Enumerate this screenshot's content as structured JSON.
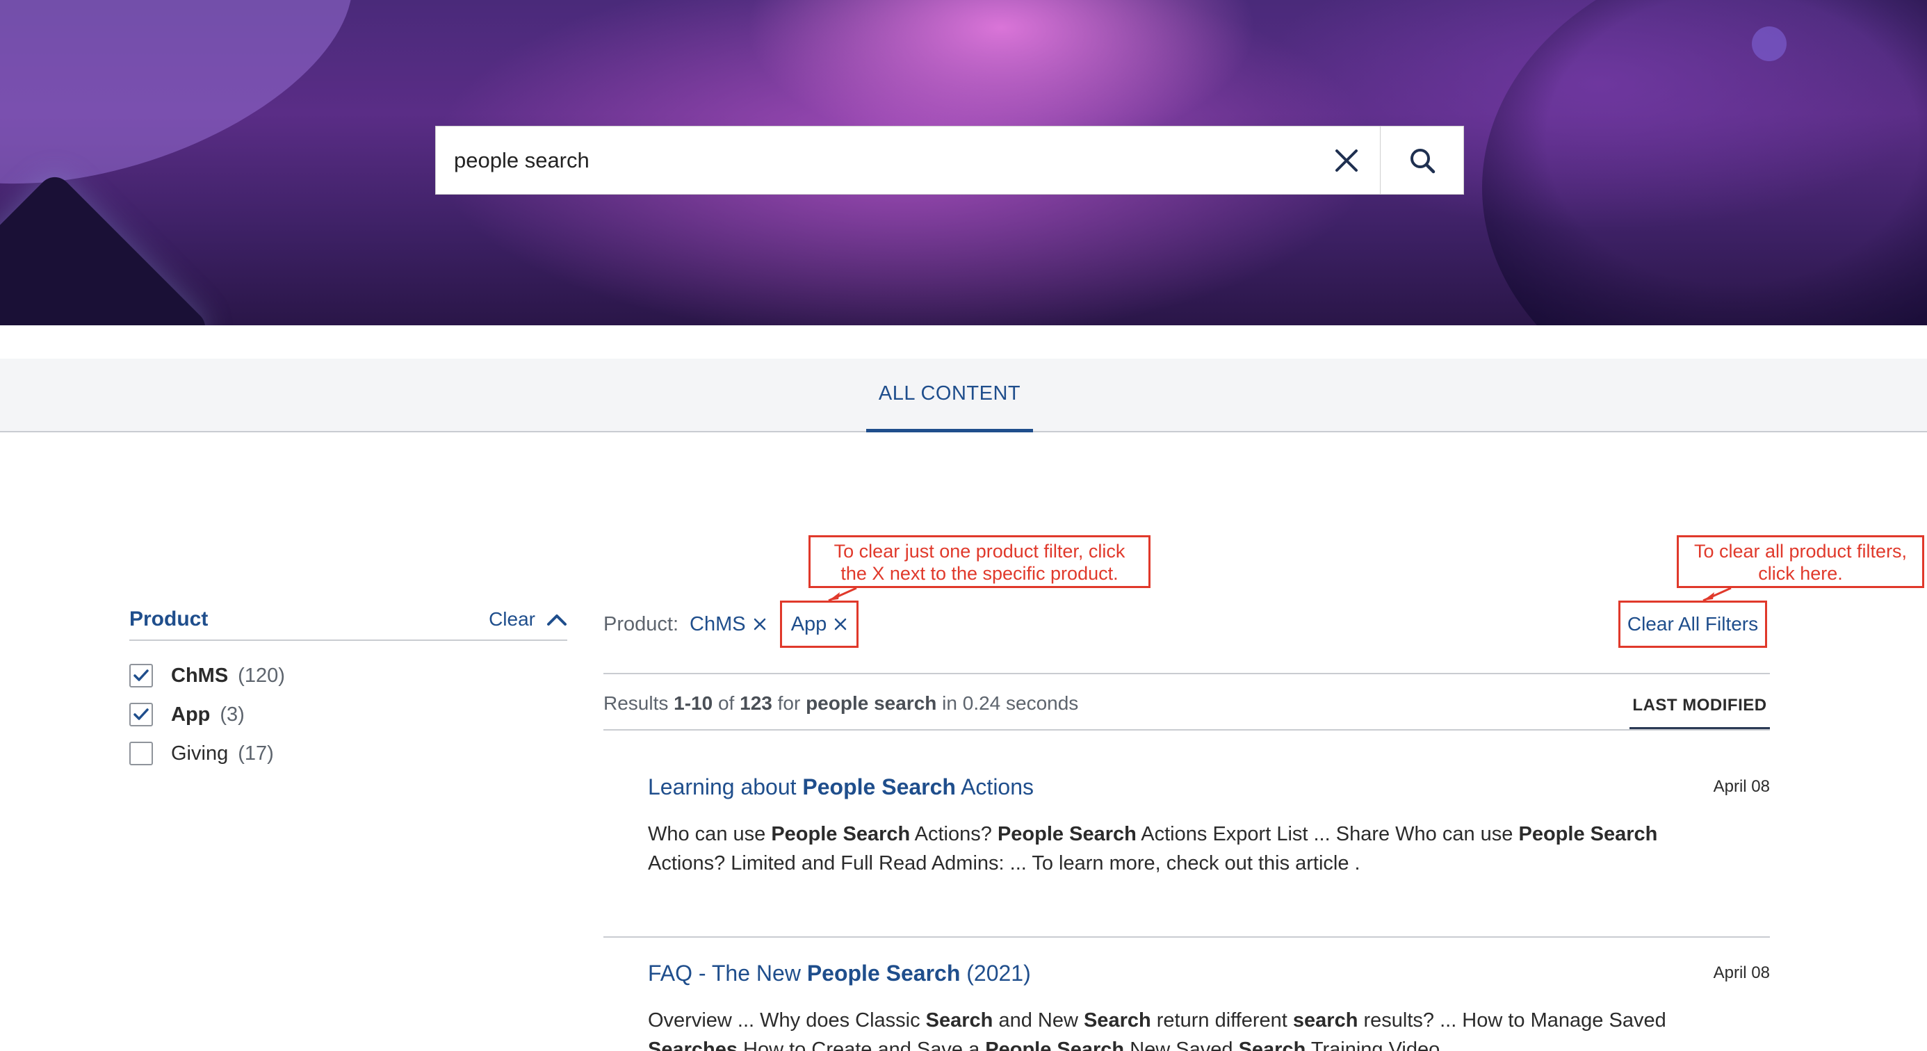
{
  "search": {
    "value": "people search"
  },
  "tabs": {
    "all_content": "ALL CONTENT"
  },
  "facet": {
    "title": "Product",
    "clear_label": "Clear",
    "items": [
      {
        "label": "ChMS",
        "count": "(120)",
        "checked": true
      },
      {
        "label": "App",
        "count": "(3)",
        "checked": true
      },
      {
        "label": "Giving",
        "count": "(17)",
        "checked": false
      }
    ]
  },
  "active_filters": {
    "label": "Product:",
    "chips": [
      "ChMS",
      "App"
    ],
    "clear_all": "Clear All Filters"
  },
  "annotations": {
    "one_filter": "To clear just one product filter, click the X next to the specific product.",
    "all_filters": "To clear all product filters, click here."
  },
  "results_meta": {
    "prefix": "Results ",
    "range": "1-10",
    "of": " of ",
    "total": "123",
    "for": " for ",
    "query": "people search",
    "time": " in 0.24 seconds"
  },
  "sort": {
    "label": "LAST MODIFIED"
  },
  "results": [
    {
      "title_pre": "Learning about ",
      "title_bold": "People Search",
      "title_post": " Actions",
      "date": "April 08",
      "snippet_parts": [
        [
          "Who can use ",
          false
        ],
        [
          "People Search",
          true
        ],
        [
          " Actions? ",
          false
        ],
        [
          "People Search",
          true
        ],
        [
          " Actions Export List ... Share Who can use ",
          false
        ],
        [
          "People Search",
          true
        ],
        [
          " Actions? Limited and Full Read Admins: ... To learn more, check out this article .",
          false
        ]
      ]
    },
    {
      "title_pre": "FAQ - The New ",
      "title_bold": "People Search",
      "title_post": " (2021)",
      "date": "April 08",
      "snippet_parts": [
        [
          "Overview ... Why does Classic ",
          false
        ],
        [
          "Search",
          true
        ],
        [
          " and New ",
          false
        ],
        [
          "Search",
          true
        ],
        [
          " return different ",
          false
        ],
        [
          "search",
          true
        ],
        [
          " results? ... How to Manage Saved ",
          false
        ],
        [
          "Searches",
          true
        ],
        [
          " How to Create and Save a ",
          false
        ],
        [
          "People Search",
          true
        ],
        [
          " New Saved ",
          false
        ],
        [
          "Search",
          true
        ],
        [
          " Training Video",
          false
        ]
      ]
    }
  ],
  "colors": {
    "link": "#1f4e8c",
    "annotation": "#e0392b"
  },
  "icons": {
    "clear": "close-icon",
    "search": "search-icon",
    "collapse": "chevron-up-icon",
    "check": "check-icon",
    "remove_chip": "close-icon"
  }
}
